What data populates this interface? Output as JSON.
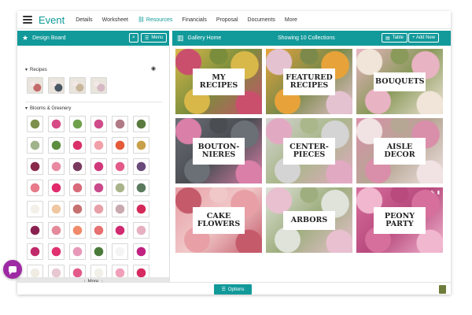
{
  "nav": {
    "brand": "Event",
    "links": [
      "Details",
      "Worksheet",
      "Resources",
      "Financials",
      "Proposal",
      "Documents",
      "More"
    ],
    "active_index": 2
  },
  "left_header": {
    "title": "Design Board",
    "menu_label": "Menu"
  },
  "right_header": {
    "title": "Gallery Home",
    "showing": "Showing 10 Collections",
    "table_label": "Table",
    "add_label": "+ Add New"
  },
  "sections": {
    "recipes": "Recipes",
    "blooms": "Blooms & Greenery"
  },
  "more_label": "More",
  "options_label": "Options",
  "tiles": [
    {
      "label": "MY RECIPES",
      "colors": [
        "#d9b84a",
        "#c94f6d",
        "#7a8d3c"
      ]
    },
    {
      "label": "FEATURED RECIPES",
      "colors": [
        "#e7a33a",
        "#e4c2cf",
        "#7b8a4a"
      ]
    },
    {
      "label": "BOUQUETS",
      "colors": [
        "#e8b3c2",
        "#f0e5d8",
        "#8a9a5b"
      ]
    },
    {
      "label": "BOUTON-NIERES",
      "colors": [
        "#6b6f76",
        "#d97fa8",
        "#4a4d52"
      ]
    },
    {
      "label": "CENTER-PIECES",
      "colors": [
        "#d4d4d4",
        "#e2a9c2",
        "#a9b78a"
      ]
    },
    {
      "label": "AISLE DECOR",
      "colors": [
        "#d98fa9",
        "#f1e3e3",
        "#b6a694"
      ]
    },
    {
      "label": "CAKE FLOWERS",
      "colors": [
        "#e8a0a6",
        "#c45a6a",
        "#f0c8c8"
      ]
    },
    {
      "label": "ARBORS",
      "colors": [
        "#dfe3da",
        "#e8c0cf",
        "#9fae7f"
      ]
    },
    {
      "label": "PEONY PARTY",
      "colors": [
        "#d66f9b",
        "#f1b7cf",
        "#b84a7e"
      ]
    }
  ],
  "recipe_thumbs": [
    "#c46a6a",
    "#4a5563",
    "#c8b59a",
    "#d6b9c4"
  ],
  "bloom_thumbs": [
    "#7d8f4a",
    "#d64a86",
    "#6fa04c",
    "#d04b8a",
    "#b07a86",
    "#5a7a3e",
    "#a1b38a",
    "#5d8d3e",
    "#d9306a",
    "#f2a0a8",
    "#e55b3a",
    "#c9a04a",
    "#8a2a4a",
    "#e88aa0",
    "#7a3a5e",
    "#d0387a",
    "#e35a8a",
    "#6a4a7a",
    "#e87a8a",
    "#e02a6a",
    "#d86a7a",
    "#c94a8a",
    "#a9b38a",
    "#5a7a5e",
    "#f3f0ea",
    "#efc7a0",
    "#c77070",
    "#e7a0a8",
    "#c9a9b0",
    "#d42a5a",
    "#8a2050",
    "#e48a9a",
    "#f08a6a",
    "#e77070",
    "#d02a70",
    "#e6b0c0",
    "#c02a6a",
    "#e03070",
    "#e898b8",
    "#4a7a3a",
    "#f4f4f4",
    "#c02080",
    "#f0ece4",
    "#e8c8d0",
    "#e35a8a",
    "#f0f0e8",
    "#f0a0b8",
    "#d62a60"
  ]
}
